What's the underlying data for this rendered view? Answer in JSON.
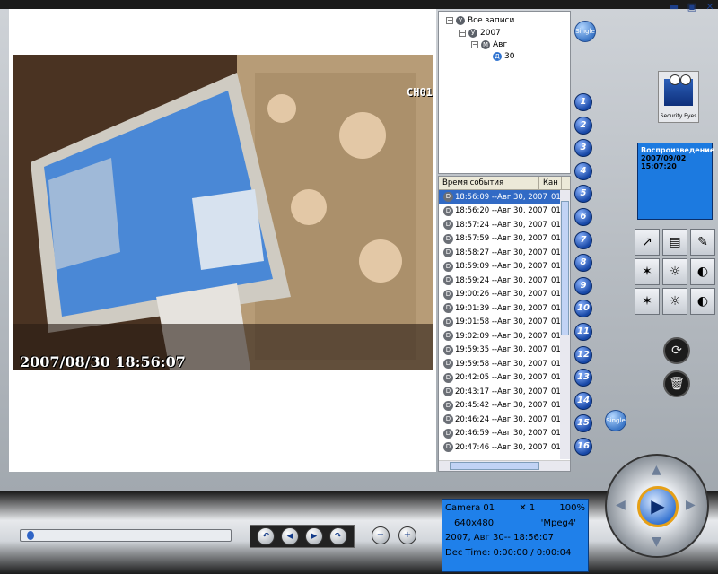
{
  "window": {
    "minimize_label": "▬",
    "restore_label": "▣",
    "close_label": "✕"
  },
  "video": {
    "osd_timestamp": "2007/08/30 18:56:07",
    "channel_label": "CH01"
  },
  "tree": {
    "root": "Все записи",
    "year": "2007",
    "month": "Авг",
    "day": "30",
    "root_icon": "У",
    "year_icon": "У",
    "month_icon": "М",
    "day_icon": "Д"
  },
  "events": {
    "columns": [
      "Время события",
      "Кан"
    ],
    "rows": [
      {
        "time": "18:56:09 --Авг 30, 2007",
        "ch": "01"
      },
      {
        "time": "18:56:20 --Авг 30, 2007",
        "ch": "01"
      },
      {
        "time": "18:57:24 --Авг 30, 2007",
        "ch": "01"
      },
      {
        "time": "18:57:59 --Авг 30, 2007",
        "ch": "01"
      },
      {
        "time": "18:58:27 --Авг 30, 2007",
        "ch": "01"
      },
      {
        "time": "18:59:09 --Авг 30, 2007",
        "ch": "01"
      },
      {
        "time": "18:59:24 --Авг 30, 2007",
        "ch": "01"
      },
      {
        "time": "19:00:26 --Авг 30, 2007",
        "ch": "01"
      },
      {
        "time": "19:01:39 --Авг 30, 2007",
        "ch": "01"
      },
      {
        "time": "19:01:58 --Авг 30, 2007",
        "ch": "01"
      },
      {
        "time": "19:02:09 --Авг 30, 2007",
        "ch": "01"
      },
      {
        "time": "19:59:35 --Авг 30, 2007",
        "ch": "01"
      },
      {
        "time": "19:59:58 --Авг 30, 2007",
        "ch": "01"
      },
      {
        "time": "20:42:05 --Авг 30, 2007",
        "ch": "01"
      },
      {
        "time": "20:43:17 --Авг 30, 2007",
        "ch": "01"
      },
      {
        "time": "20:45:42 --Авг 30, 2007",
        "ch": "01"
      },
      {
        "time": "20:46:24 --Авг 30, 2007",
        "ch": "01"
      },
      {
        "time": "20:46:59 --Авг 30, 2007",
        "ch": "01"
      },
      {
        "time": "20:47:46 --Авг 30, 2007",
        "ch": "01"
      }
    ],
    "row_icon": "D"
  },
  "channels": [
    "1",
    "2",
    "3",
    "4",
    "5",
    "6",
    "7",
    "8",
    "9",
    "10",
    "11",
    "12",
    "13",
    "14",
    "15",
    "16"
  ],
  "single_label": "Single",
  "logo_text": "Security Eyes",
  "status": {
    "title": "Воспроизведение",
    "date": "2007/09/02",
    "time": "15:07:20"
  },
  "info": {
    "camera": "Camera 01",
    "speed": "✕ 1",
    "zoom": "100%",
    "resolution": "640x480",
    "codec": "'Mpeg4'",
    "datetime": "2007, Авг 30-- 18:56:07",
    "dec_time": "Dec Time: 0:00:00 / 0:00:04"
  },
  "seek": {
    "position": 0.03
  },
  "colors": {
    "accent": "#1f80ea",
    "selection": "#316ac5"
  }
}
